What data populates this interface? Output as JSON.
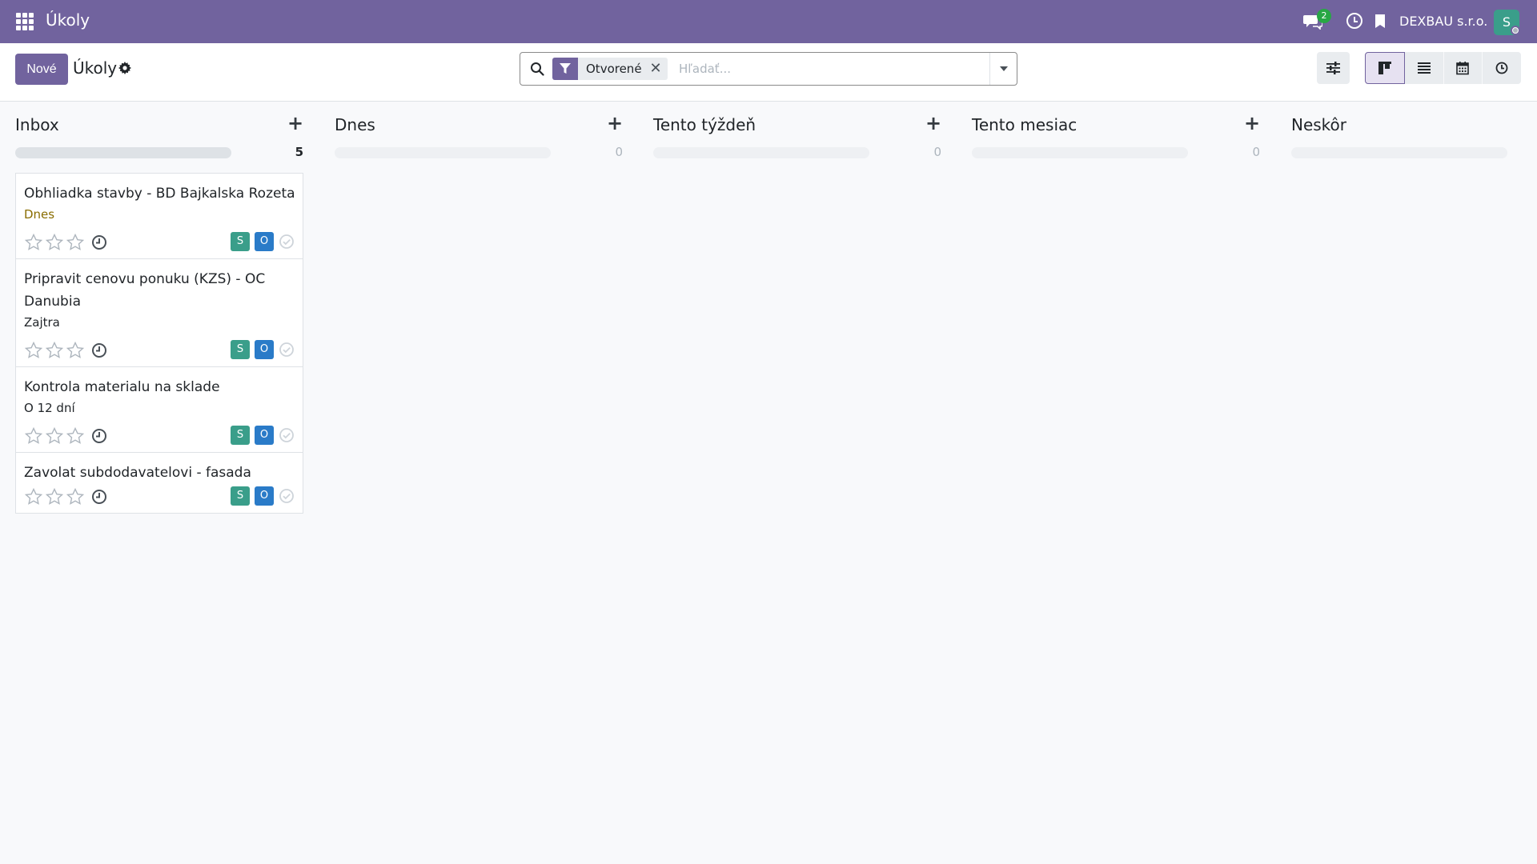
{
  "navbar": {
    "app_title": "Úkoly",
    "chat_badge": "2",
    "company": "DEXBAU s.r.o.",
    "user_initial": "S",
    "bg_color": "#71639e"
  },
  "control_panel": {
    "new_button": "Nové",
    "title": "Úkoly",
    "search": {
      "facet_label": "Otvorené",
      "placeholder": "Hľadať..."
    }
  },
  "columns": [
    {
      "title": "Inbox",
      "count": "5"
    },
    {
      "title": "Dnes",
      "count": "0"
    },
    {
      "title": "Tento týždeň",
      "count": "0"
    },
    {
      "title": "Tento mesiac",
      "count": "0"
    },
    {
      "title": "Neskôr",
      "count": ""
    }
  ],
  "cards": [
    {
      "title": "Obhliadka stavby - BD Bajkalska Rozeta",
      "date": "Dnes",
      "assignees": [
        "S",
        "O"
      ]
    },
    {
      "title": "Pripravit cenovu ponuku (KZS) - OC Danubia",
      "date": "Zajtra",
      "assignees": [
        "S",
        "O"
      ]
    },
    {
      "title": "Kontrola materialu na sklade",
      "date": "O 12 dní",
      "assignees": [
        "S",
        "O"
      ]
    },
    {
      "title": "Zavolat subdodavatelovi - fasada",
      "date": "",
      "assignees": [
        "S",
        "O"
      ]
    }
  ]
}
